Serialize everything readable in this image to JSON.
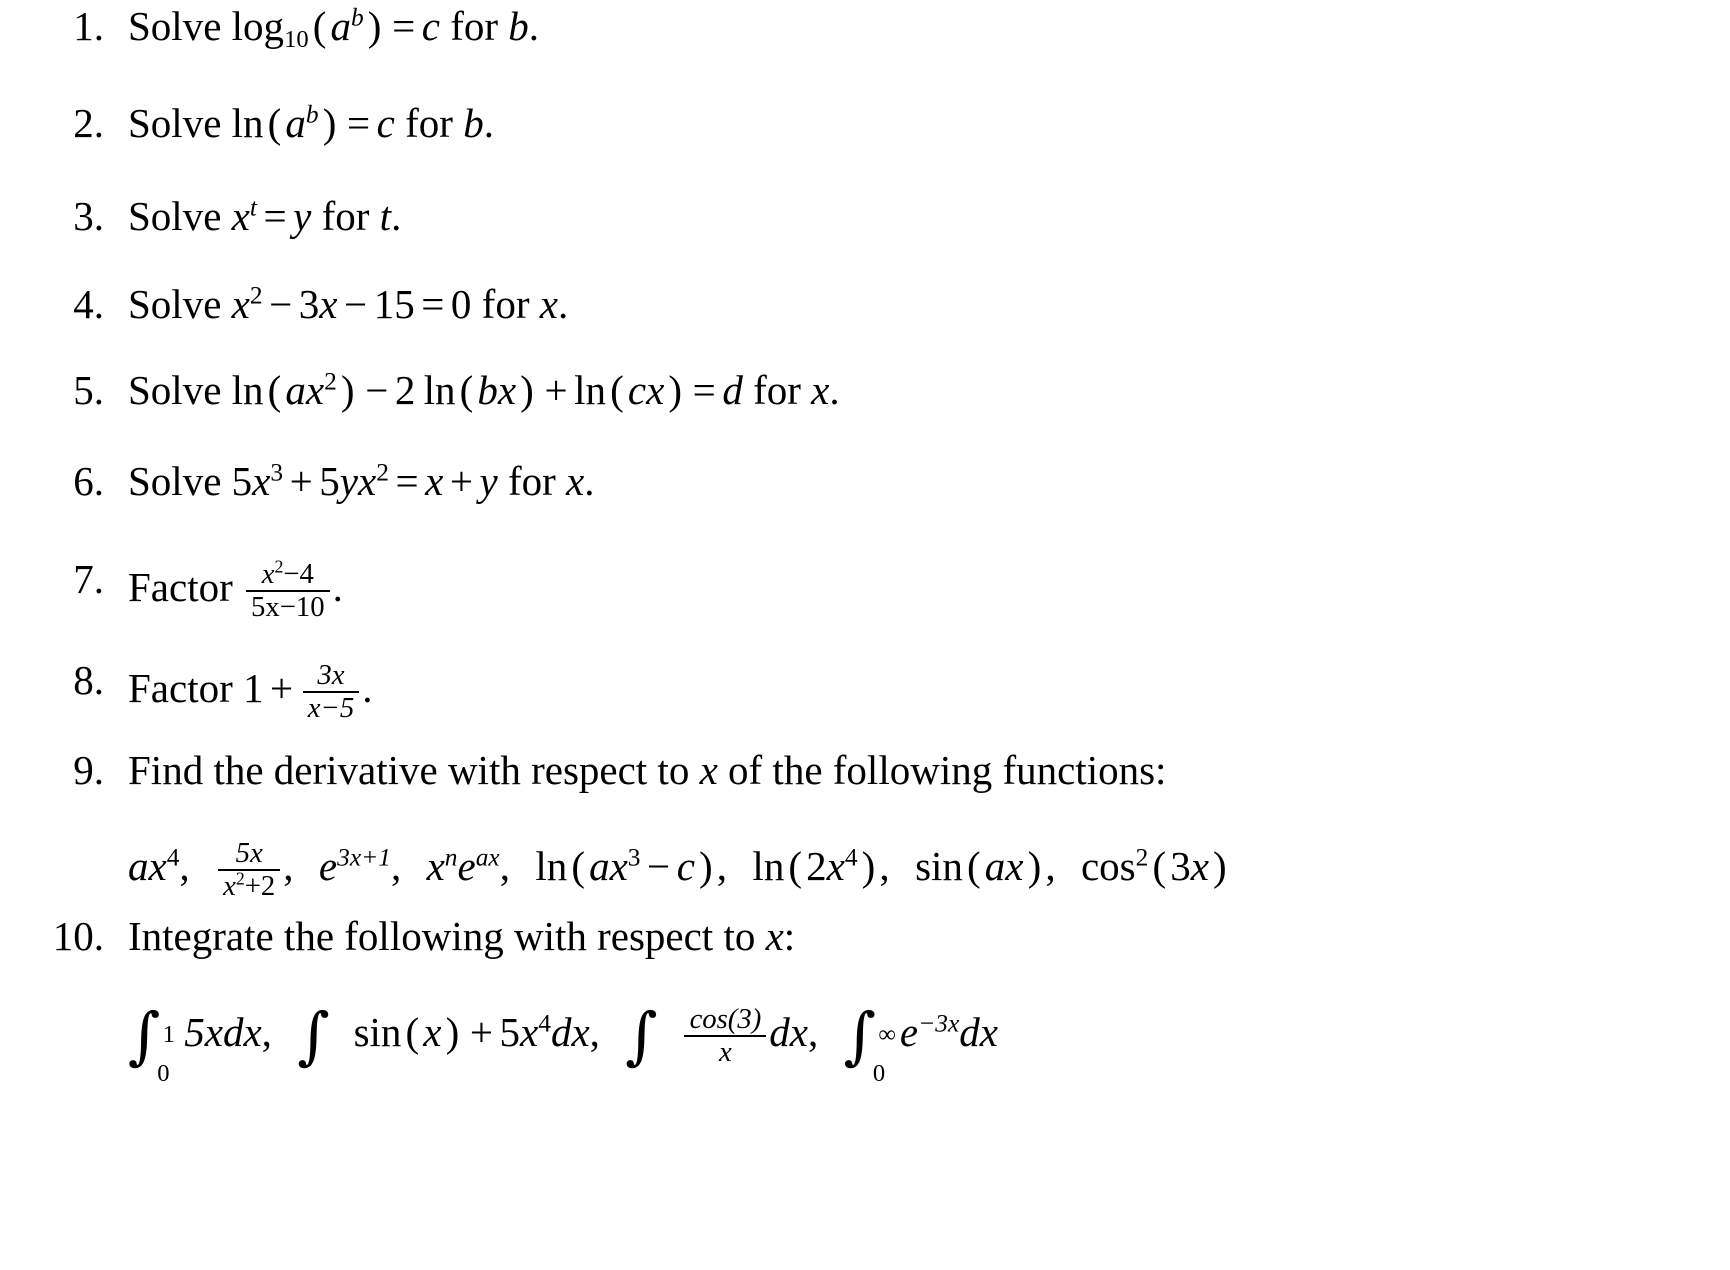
{
  "document": {
    "type": "math-problem-set",
    "problem_count": 10,
    "background_color": "#ffffff",
    "text_color": "#000000"
  },
  "problems": [
    {
      "number": "1.",
      "verb": "Solve",
      "statement": "Solve log_10(a^b) = c for b.",
      "parts": {
        "func": "log",
        "base": "10",
        "arg_var": "a",
        "arg_exp": "b",
        "equals": "=",
        "rhs": "c",
        "for_word": "for",
        "for_var": "b",
        "period": "."
      }
    },
    {
      "number": "2.",
      "verb": "Solve",
      "statement": "Solve ln(a^b) = c for b.",
      "parts": {
        "func": "ln",
        "arg_var": "a",
        "arg_exp": "b",
        "equals": "=",
        "rhs": "c",
        "for_word": "for",
        "for_var": "b",
        "period": "."
      }
    },
    {
      "number": "3.",
      "verb": "Solve",
      "statement": "Solve x^t = y for t.",
      "parts": {
        "base_var": "x",
        "exp_var": "t",
        "equals": "=",
        "rhs": "y",
        "for_word": "for",
        "for_var": "t",
        "period": "."
      }
    },
    {
      "number": "4.",
      "verb": "Solve",
      "statement": "Solve x^2 - 3x - 15 = 0 for x.",
      "parts": {
        "term1_var": "x",
        "term1_exp": "2",
        "minus1": "−",
        "term2": "3",
        "term2_var": "x",
        "minus2": "−",
        "term3": "15",
        "equals": "=",
        "rhs": "0",
        "for_word": "for",
        "for_var": "x",
        "period": "."
      }
    },
    {
      "number": "5.",
      "verb": "Solve",
      "statement": "Solve ln(ax^2) - 2 ln(bx) + ln(cx) = d for x.",
      "parts": {
        "f1": "ln",
        "f1a": "a",
        "f1b": "x",
        "f1exp": "2",
        "minus": "−",
        "coef2": "2",
        "f2": "ln",
        "f2a": "b",
        "f2b": "x",
        "plus": "+",
        "f3": "ln",
        "f3a": "c",
        "f3b": "x",
        "equals": "=",
        "rhs": "d",
        "for_word": "for",
        "for_var": "x",
        "period": "."
      }
    },
    {
      "number": "6.",
      "verb": "Solve",
      "statement": "Solve 5x^3 + 5yx^2 = x + y for x.",
      "parts": {
        "c1": "5",
        "v1": "x",
        "e1": "3",
        "plus1": "+",
        "c2": "5",
        "v2a": "y",
        "v2b": "x",
        "e2": "2",
        "equals": "=",
        "r1": "x",
        "plus2": "+",
        "r2": "y",
        "for_word": "for",
        "for_var": "x",
        "period": "."
      }
    },
    {
      "number": "7.",
      "verb": "Factor",
      "statement": "Factor (x^2 - 4)/(5x - 10).",
      "parts": {
        "num_var": "x",
        "num_exp": "2",
        "num_minus": "−4",
        "den": "5x−10",
        "period": "."
      }
    },
    {
      "number": "8.",
      "verb": "Factor",
      "statement": "Factor 1 + 3x/(x - 5).",
      "parts": {
        "one": "1",
        "plus": "+",
        "num": "3x",
        "den": "x−5",
        "period": "."
      }
    },
    {
      "number": "9.",
      "verb": "Find",
      "statement": "Find the derivative with respect to x of the following functions:",
      "text_before": "Find the derivative with respect to",
      "text_var": "x",
      "text_after": "of the following functions:",
      "functions": [
        "ax^4",
        "5x/(x^2+2)",
        "e^(3x+1)",
        "x^n e^(ax)",
        "ln(ax^3 - c)",
        "ln(2x^4)",
        "sin(ax)",
        "cos^2(3x)"
      ],
      "function_tokens": {
        "f1": {
          "coef": "a",
          "var": "x",
          "exp": "4",
          "comma": ","
        },
        "f2": {
          "num": "5x",
          "den": "x",
          "den_exp": "2",
          "den_plus": "+2",
          "comma": ","
        },
        "f3": {
          "base": "e",
          "exp": "3x+1",
          "comma": ","
        },
        "f4": {
          "var": "x",
          "exp": "n",
          "base": "e",
          "base_exp": "ax",
          "comma": ","
        },
        "f5": {
          "name": "ln",
          "a": "a",
          "v": "x",
          "e": "3",
          "minus": "−",
          "c": "c",
          "comma": ","
        },
        "f6": {
          "name": "ln",
          "coef": "2",
          "v": "x",
          "e": "4",
          "comma": ","
        },
        "f7": {
          "name": "sin",
          "a": "a",
          "v": "x",
          "comma": ","
        },
        "f8": {
          "name": "cos",
          "exp": "2",
          "coef": "3",
          "v": "x"
        }
      }
    },
    {
      "number": "10.",
      "verb": "Integrate",
      "statement": "Integrate the following with respect to x:",
      "text_before": "Integrate the following with respect to",
      "text_var": "x",
      "text_after": ":",
      "integrals": [
        "∫_0^1 5x dx",
        "∫ sin(x) + 5x^4 dx",
        "∫ cos(3)/x dx",
        "∫_0^∞ e^(-3x) dx"
      ],
      "integral_tokens": {
        "i1": {
          "sign": "∫",
          "lower": "0",
          "upper": "1",
          "body": "5xdx",
          "comma": ","
        },
        "i2": {
          "sign": "∫",
          "fn": "sin",
          "v": "x",
          "plus": "+",
          "coef": "5",
          "v2": "x",
          "exp": "4",
          "dx": "dx",
          "comma": ","
        },
        "i3": {
          "sign": "∫",
          "num": "cos(3)",
          "den": "x",
          "dx": "dx",
          "comma": ","
        },
        "i4": {
          "sign": "∫",
          "lower": "0",
          "upper": "∞",
          "base": "e",
          "exp": "−3x",
          "dx": "dx"
        }
      }
    }
  ]
}
